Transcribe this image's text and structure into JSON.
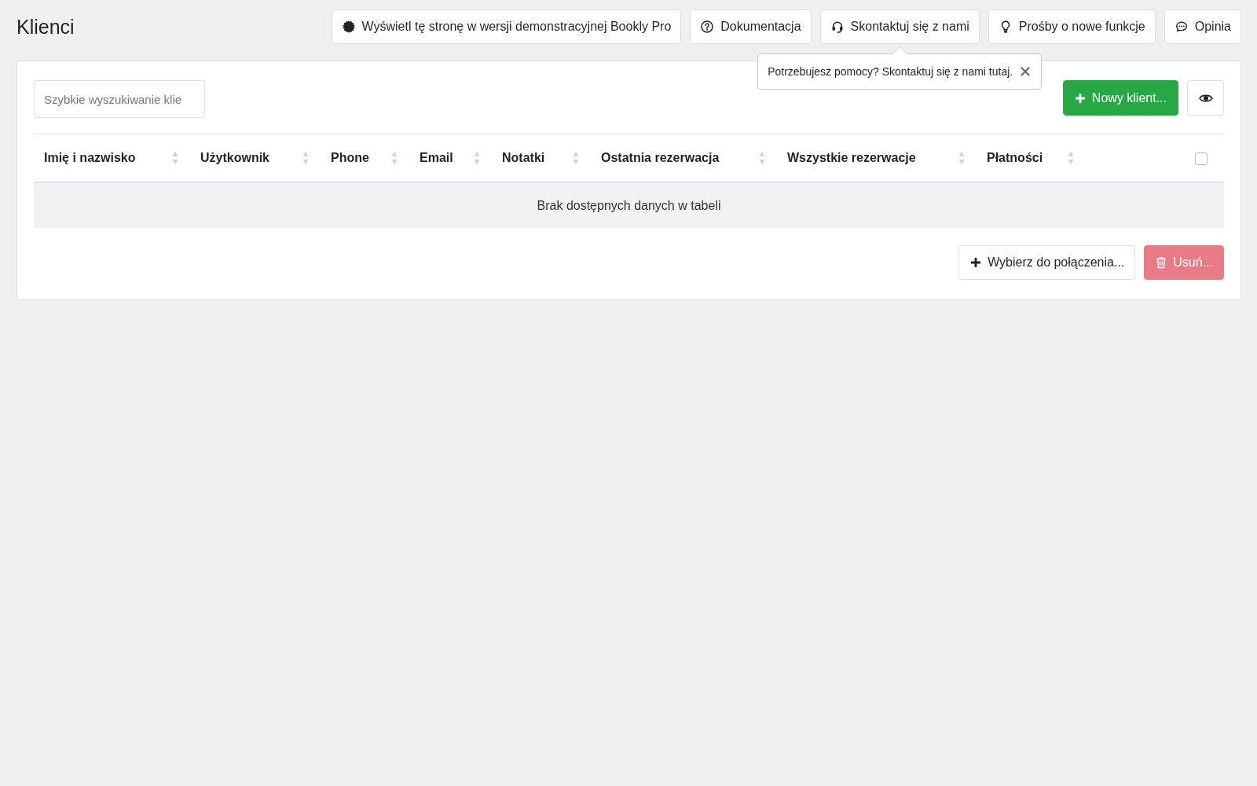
{
  "page": {
    "title": "Klienci"
  },
  "toolbar": [
    {
      "kind": "demo",
      "label": "Wyświetl tę stronę w wersji demonstracyjnej Bookly Pro"
    },
    {
      "kind": "docs",
      "label": "Dokumentacja"
    },
    {
      "kind": "contact",
      "label": "Skontaktuj się z nami",
      "popover": {
        "text": "Potrzebujesz pomocy? Skontaktuj się z nami tutaj."
      }
    },
    {
      "kind": "ideas",
      "label": "Prośby o nowe funkcje"
    },
    {
      "kind": "feedback",
      "label": "Opinia"
    }
  ],
  "search": {
    "placeholder": "Szybkie wyszukiwanie klie"
  },
  "new_client_button": {
    "label": "Nowy klient..."
  },
  "table": {
    "columns": [
      {
        "label": "Imię i nazwisko"
      },
      {
        "label": "Użytkownik"
      },
      {
        "label": "Phone"
      },
      {
        "label": "Email"
      },
      {
        "label": "Notatki"
      },
      {
        "label": "Ostatnia rezerwacja"
      },
      {
        "label": "Wszystkie rezerwacje"
      },
      {
        "label": "Płatności"
      }
    ],
    "select_all": {
      "checked": false
    },
    "empty_message": "Brak dostępnych danych w tabeli"
  },
  "actions": [
    {
      "kind": "merge",
      "label": "Wybierz do połączenia...",
      "disabled": false
    },
    {
      "kind": "delete",
      "label": "Usuń...",
      "disabled": true
    }
  ]
}
